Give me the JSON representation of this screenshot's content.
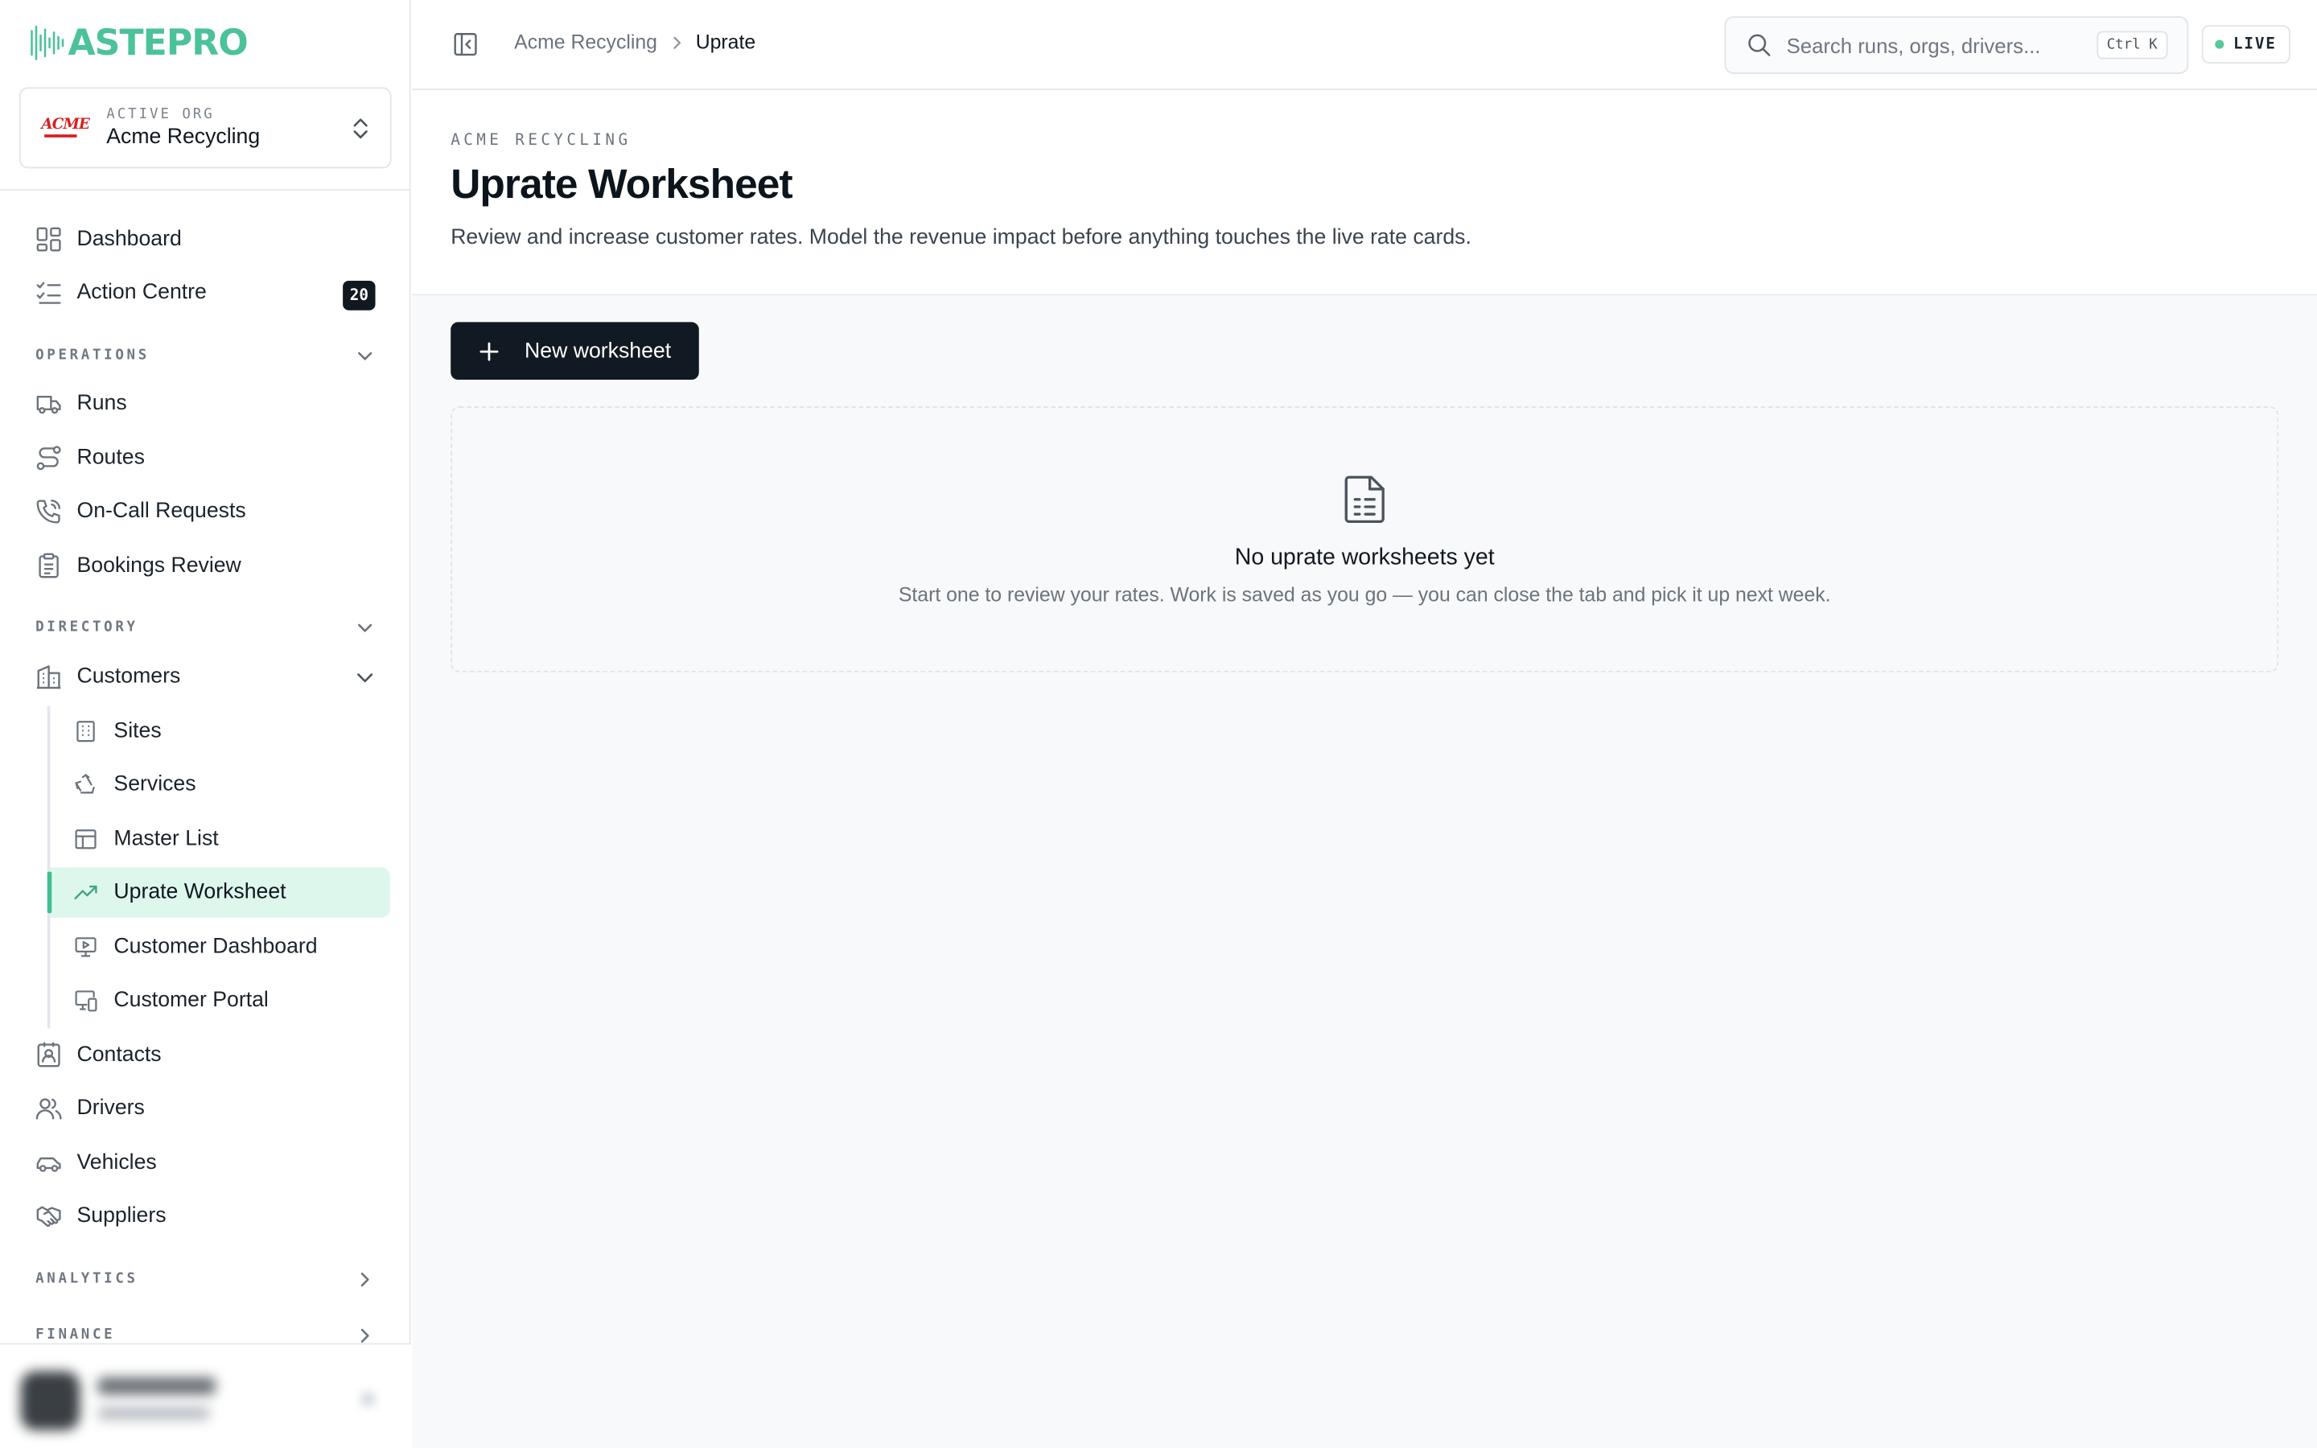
{
  "app": {
    "brand": "ASTEPRO"
  },
  "org_switcher": {
    "eyebrow": "ACTIVE ORG",
    "name": "Acme Recycling",
    "logo_text": "ACME"
  },
  "sidebar": {
    "top_items": [
      {
        "label": "Dashboard",
        "icon": "dashboard-grid-icon"
      },
      {
        "label": "Action Centre",
        "icon": "checklist-icon",
        "badge": "20"
      }
    ],
    "sections": {
      "operations": {
        "label": "OPERATIONS",
        "expanded": true
      },
      "directory": {
        "label": "DIRECTORY",
        "expanded": true
      },
      "analytics": {
        "label": "ANALYTICS",
        "expanded": false
      },
      "finance": {
        "label": "FINANCE",
        "expanded": false
      }
    },
    "operations_items": [
      {
        "label": "Runs",
        "icon": "truck-icon"
      },
      {
        "label": "Routes",
        "icon": "route-icon"
      },
      {
        "label": "On-Call Requests",
        "icon": "phone-call-icon"
      },
      {
        "label": "Bookings Review",
        "icon": "clipboard-icon"
      }
    ],
    "customers": {
      "label": "Customers",
      "icon": "building-icon",
      "expanded": true
    },
    "customer_sub_items": [
      {
        "label": "Sites",
        "icon": "office-building-icon",
        "active": false
      },
      {
        "label": "Services",
        "icon": "recycle-icon",
        "active": false
      },
      {
        "label": "Master List",
        "icon": "table-icon",
        "active": false
      },
      {
        "label": "Uprate Worksheet",
        "icon": "trending-up-icon",
        "active": true
      },
      {
        "label": "Customer Dashboard",
        "icon": "presentation-icon",
        "active": false
      },
      {
        "label": "Customer Portal",
        "icon": "monitor-phone-icon",
        "active": false
      }
    ],
    "directory_items": [
      {
        "label": "Contacts",
        "icon": "contact-card-icon"
      },
      {
        "label": "Drivers",
        "icon": "users-icon"
      },
      {
        "label": "Vehicles",
        "icon": "car-icon"
      },
      {
        "label": "Suppliers",
        "icon": "handshake-icon"
      }
    ]
  },
  "topbar": {
    "breadcrumb": {
      "parent": "Acme Recycling",
      "current": "Uprate"
    },
    "search_placeholder": "Search runs, orgs, drivers...",
    "shortcut": "Ctrl K",
    "status": "LIVE"
  },
  "page": {
    "eyebrow": "ACME RECYCLING",
    "title": "Uprate Worksheet",
    "description": "Review and increase customer rates. Model the revenue impact before anything touches the live rate cards."
  },
  "actions": {
    "new_worksheet": "New worksheet"
  },
  "empty_state": {
    "title": "No uprate worksheets yet",
    "subtitle": "Start one to review your rates. Work is saved as you go — you can close the tab and pick it up next week."
  },
  "colors": {
    "accent": "#3fbf8f",
    "brand": "#4cc29a",
    "active_bg": "#def7ec",
    "primary_button": "#111a22",
    "badge_bg": "#111820"
  }
}
